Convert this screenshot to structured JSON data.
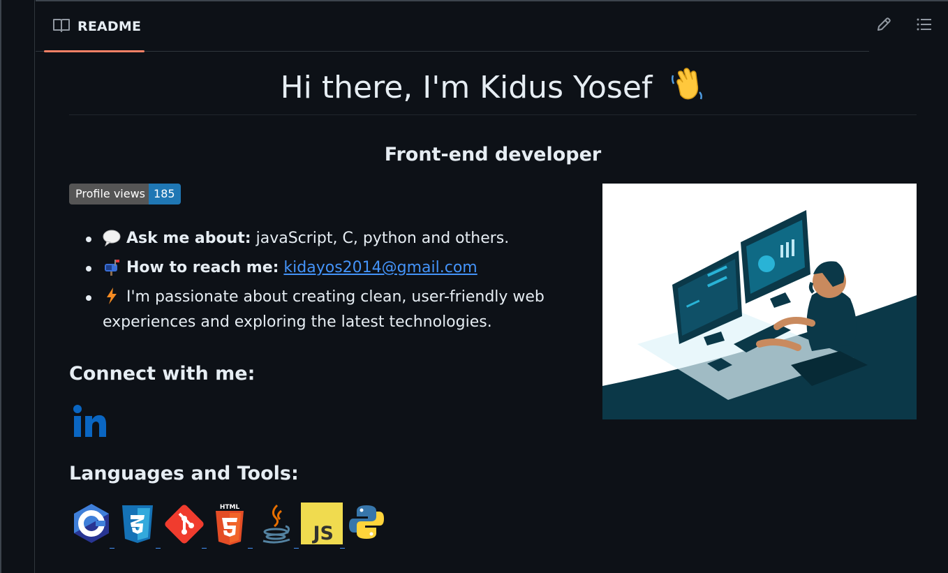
{
  "tab": {
    "label": "README",
    "icon": "book-icon"
  },
  "toolbar": {
    "edit_icon": "pencil-icon",
    "toc_icon": "list-icon"
  },
  "readme": {
    "title": "Hi there, I'm Kidus Yosef",
    "title_emoji": "waving-hand-icon",
    "subtitle": "Front-end developer",
    "badge": {
      "label": "Profile views",
      "count": "185",
      "label_color": "#555555",
      "count_color": "#1f77b4"
    },
    "bullets": [
      {
        "icon": "speech-bubble-icon",
        "bold": "Ask me about:",
        "text": " javaScript, C, python and others."
      },
      {
        "icon": "mailbox-icon",
        "bold": "How to reach me:",
        "link": "kidayos2014@gmail.com"
      },
      {
        "icon": "lightning-icon",
        "text": "I'm passionate about creating clean, user-friendly web experiences and exploring the latest technologies."
      }
    ],
    "connect_heading": "Connect with me:",
    "connect_icons": [
      "linkedin-icon"
    ],
    "tools_heading": "Languages and Tools:",
    "tools": [
      {
        "name": "c-icon",
        "text": "C"
      },
      {
        "name": "css3-icon",
        "text": "3"
      },
      {
        "name": "git-icon",
        "text": ""
      },
      {
        "name": "html5-icon",
        "text": "5"
      },
      {
        "name": "java-icon",
        "text": ""
      },
      {
        "name": "javascript-icon",
        "text": "JS"
      },
      {
        "name": "python-icon",
        "text": ""
      }
    ],
    "hero_image": "developer-at-computer-illustration"
  },
  "colors": {
    "background": "#0d1117",
    "accent_underline": "#f78166",
    "link": "#4493f8",
    "border": "#30363d"
  }
}
